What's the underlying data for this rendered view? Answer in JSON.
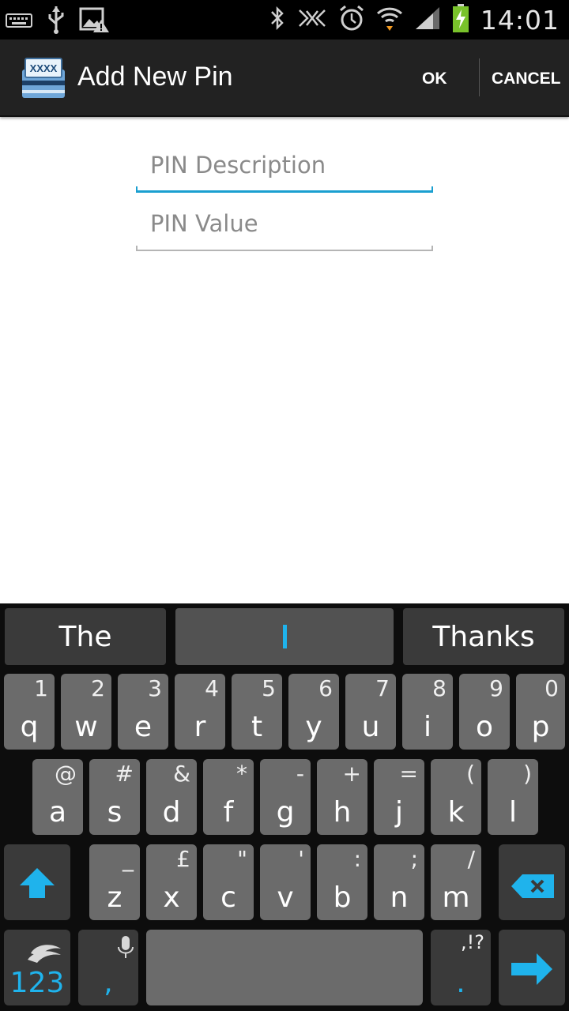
{
  "status_bar": {
    "time": "14:01",
    "left_icons": [
      "keyboard-icon",
      "usb-icon",
      "image-warning-icon"
    ],
    "right_icons": [
      "bluetooth-icon",
      "nfc-icon",
      "alarm-icon",
      "wifi-icon",
      "signal-icon",
      "battery-charging-icon"
    ]
  },
  "action_bar": {
    "app_icon_text": "XXXX",
    "title": "Add New Pin",
    "ok_label": "OK",
    "cancel_label": "CANCEL"
  },
  "form": {
    "description_placeholder": "PIN Description",
    "value_placeholder": "PIN Value"
  },
  "keyboard": {
    "suggestions": [
      "The",
      "",
      "Thanks"
    ],
    "row1": [
      {
        "main": "q",
        "sec": "1"
      },
      {
        "main": "w",
        "sec": "2"
      },
      {
        "main": "e",
        "sec": "3"
      },
      {
        "main": "r",
        "sec": "4"
      },
      {
        "main": "t",
        "sec": "5"
      },
      {
        "main": "y",
        "sec": "6"
      },
      {
        "main": "u",
        "sec": "7"
      },
      {
        "main": "i",
        "sec": "8"
      },
      {
        "main": "o",
        "sec": "9"
      },
      {
        "main": "p",
        "sec": "0"
      }
    ],
    "row2": [
      {
        "main": "a",
        "sec": "@"
      },
      {
        "main": "s",
        "sec": "#"
      },
      {
        "main": "d",
        "sec": "&"
      },
      {
        "main": "f",
        "sec": "*"
      },
      {
        "main": "g",
        "sec": "-"
      },
      {
        "main": "h",
        "sec": "+"
      },
      {
        "main": "j",
        "sec": "="
      },
      {
        "main": "k",
        "sec": "("
      },
      {
        "main": "l",
        "sec": ")"
      }
    ],
    "row3": [
      {
        "main": "z",
        "sec": "_"
      },
      {
        "main": "x",
        "sec": "£"
      },
      {
        "main": "c",
        "sec": "\""
      },
      {
        "main": "v",
        "sec": "'"
      },
      {
        "main": "b",
        "sec": ":"
      },
      {
        "main": "n",
        "sec": ";"
      },
      {
        "main": "m",
        "sec": "/"
      }
    ],
    "symbols_label": "123",
    "comma_label": ",",
    "punct_top": ",!?",
    "period_label": "."
  }
}
